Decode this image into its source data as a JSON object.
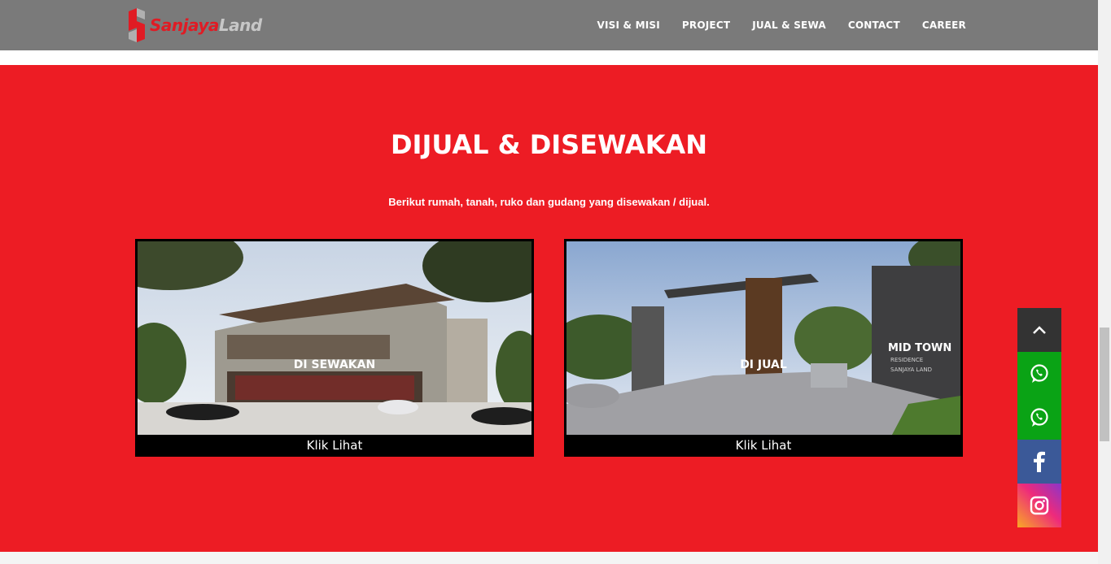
{
  "brand": {
    "name_part1": "Sanjaya",
    "name_part2": "Land"
  },
  "nav": {
    "items": [
      {
        "label": "VISI & MISI"
      },
      {
        "label": "PROJECT"
      },
      {
        "label": "JUAL & SEWA"
      },
      {
        "label": "CONTACT"
      },
      {
        "label": "CAREER"
      }
    ]
  },
  "section": {
    "title": "DIJUAL & DISEWAKAN",
    "subtitle": "Berikut rumah, tanah, ruko dan gudang yang disewakan / dijual."
  },
  "cards": [
    {
      "overlay": "DI SEWAKAN",
      "caption": "Klik Lihat"
    },
    {
      "overlay": "DI JUAL",
      "caption": "Klik Lihat",
      "sign_line1": "MID TOWN",
      "sign_line2": "RESIDENCE",
      "sign_line3": "SANJAYA LAND"
    }
  ],
  "floating": {
    "icons": [
      "chevron-up-icon",
      "whatsapp-icon",
      "whatsapp-icon",
      "facebook-icon",
      "instagram-icon"
    ]
  },
  "colors": {
    "header_bg": "#7a7a7a",
    "section_bg": "#ed1c24",
    "brand_red": "#e01b24",
    "whatsapp_green": "#0aa315",
    "facebook_blue": "#3b5998"
  }
}
